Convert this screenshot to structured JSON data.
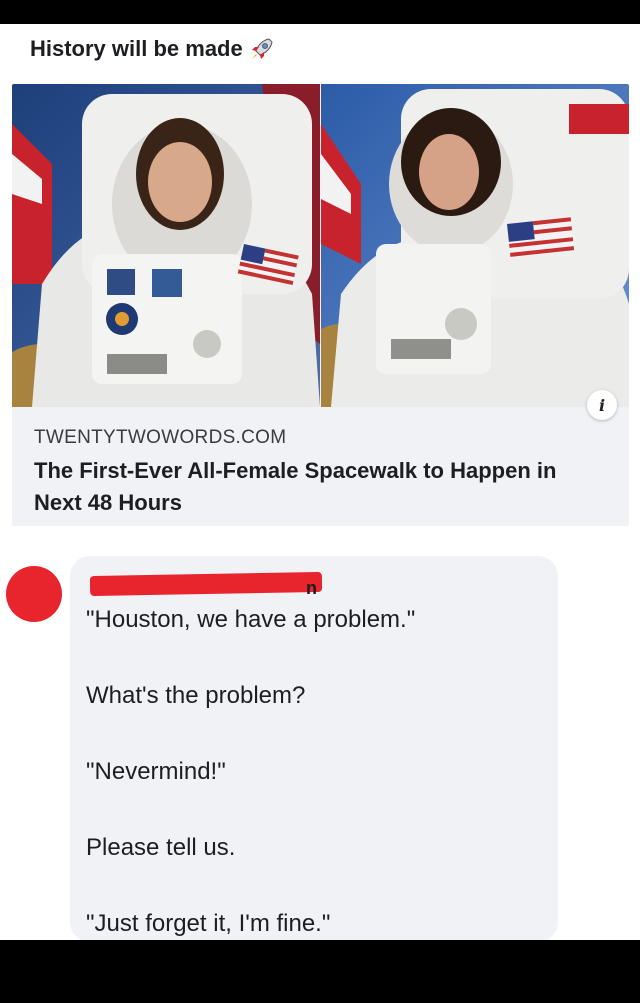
{
  "post": {
    "text": "History will be made"
  },
  "link_preview": {
    "domain": "TWENTYTWOWORDS.COM",
    "title": "The First-Ever All-Female Spacewalk to Happen in Next 48 Hours"
  },
  "comment": {
    "name_tail": "n",
    "lines": [
      "\"Houston, we have a problem.\"",
      "What's the problem?",
      "\"Nevermind!\"",
      "Please tell us.",
      "\"Just forget it, I'm fine.\""
    ]
  },
  "icons": {
    "post_emoji": "rocket-icon",
    "info": "info-icon"
  },
  "colors": {
    "redaction": "#e8242d",
    "card_bg": "#f0f2f5",
    "text": "#1c1e21"
  }
}
